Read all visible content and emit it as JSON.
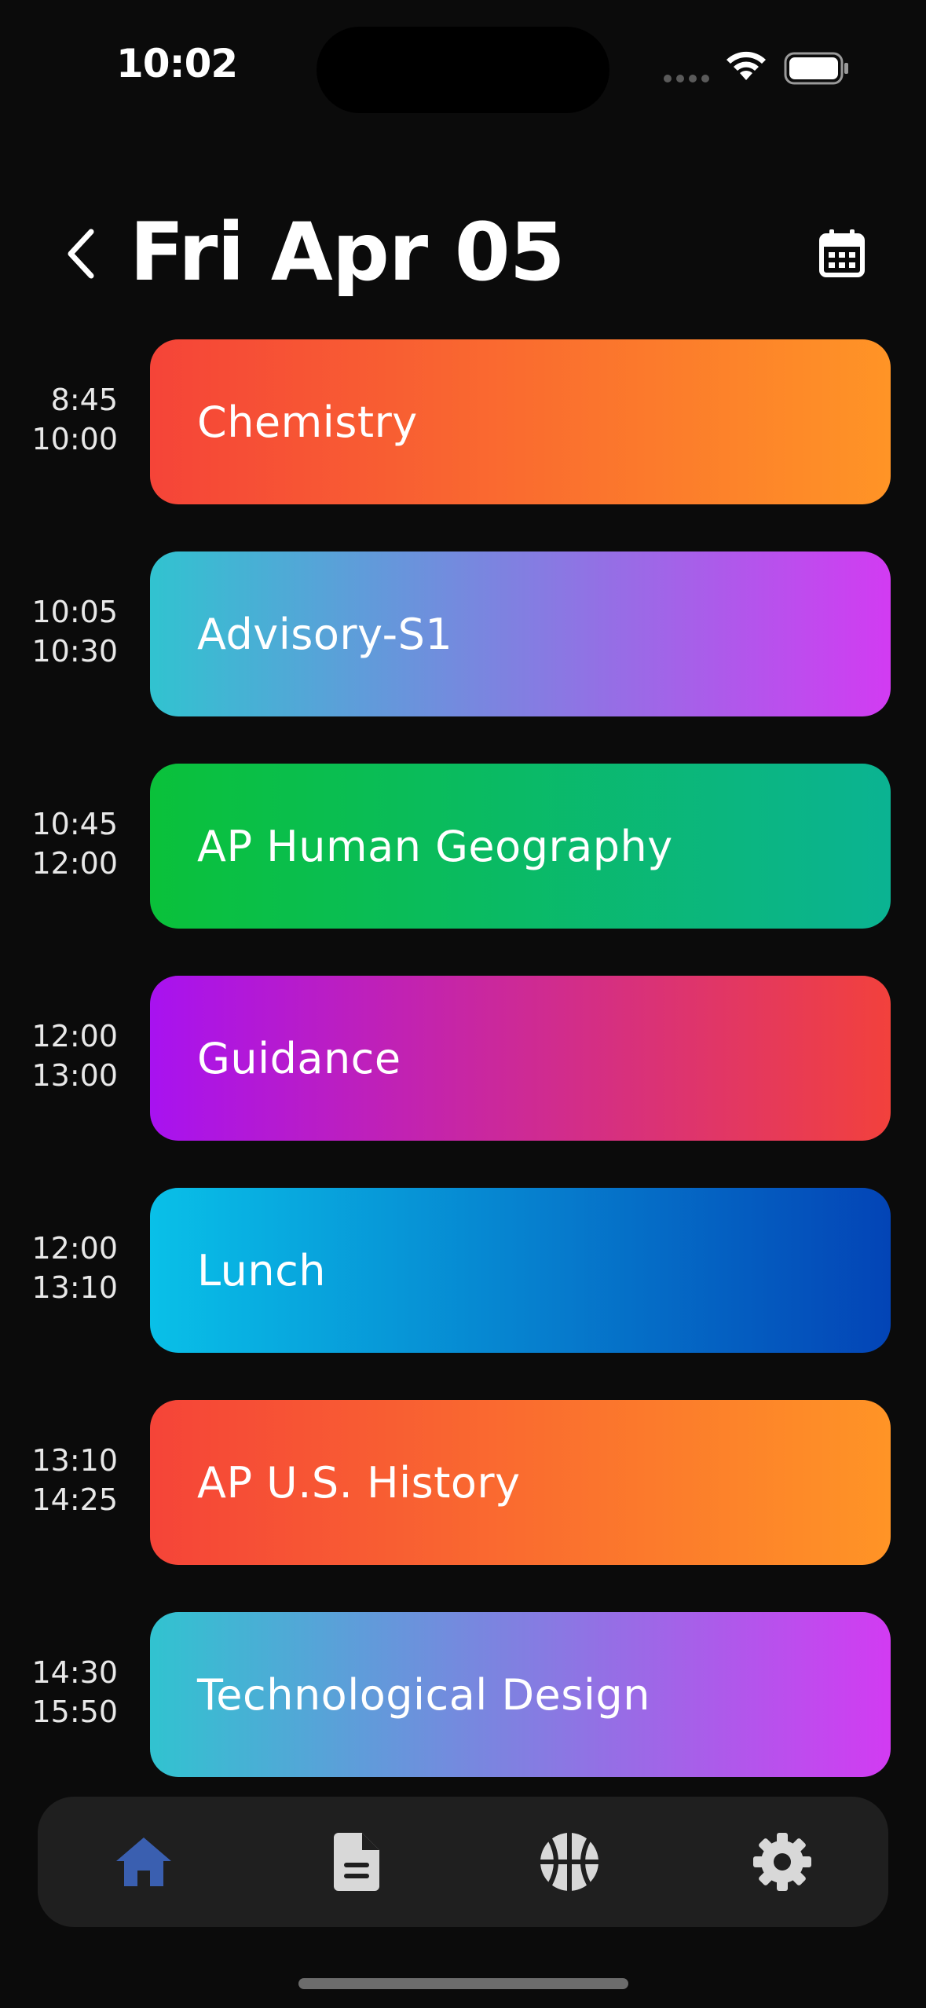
{
  "status_bar": {
    "time": "10:02"
  },
  "header": {
    "title": "Fri Apr 05"
  },
  "schedule": [
    {
      "start": "8:45",
      "end": "10:00",
      "name": "Chemistry",
      "gradient": [
        "#f54438",
        "#ff9426"
      ]
    },
    {
      "start": "10:05",
      "end": "10:30",
      "name": "Advisory-S1",
      "gradient": [
        "#31c3d0",
        "#d23bf2"
      ]
    },
    {
      "start": "10:45",
      "end": "12:00",
      "name": "AP Human Geography",
      "gradient": [
        "#0ac13a",
        "#0bb392"
      ]
    },
    {
      "start": "12:00",
      "end": "13:00",
      "name": "Guidance",
      "gradient": [
        "#a812f0",
        "#f2413c"
      ]
    },
    {
      "start": "12:00",
      "end": "13:10",
      "name": "Lunch",
      "gradient": [
        "#09c0e8",
        "#0344b6"
      ]
    },
    {
      "start": "13:10",
      "end": "14:25",
      "name": "AP U.S. History",
      "gradient": [
        "#f54438",
        "#ff9426"
      ]
    },
    {
      "start": "14:30",
      "end": "15:50",
      "name": "Technological Design",
      "gradient": [
        "#31c3d0",
        "#d23bf2"
      ]
    }
  ],
  "tabbar": {
    "items": [
      {
        "icon": "home-icon",
        "active": true
      },
      {
        "icon": "document-icon",
        "active": false
      },
      {
        "icon": "basketball-icon",
        "active": false
      },
      {
        "icon": "gear-icon",
        "active": false
      }
    ],
    "active_color": "#3a5fb0",
    "inactive_color": "#d8d8d8"
  }
}
